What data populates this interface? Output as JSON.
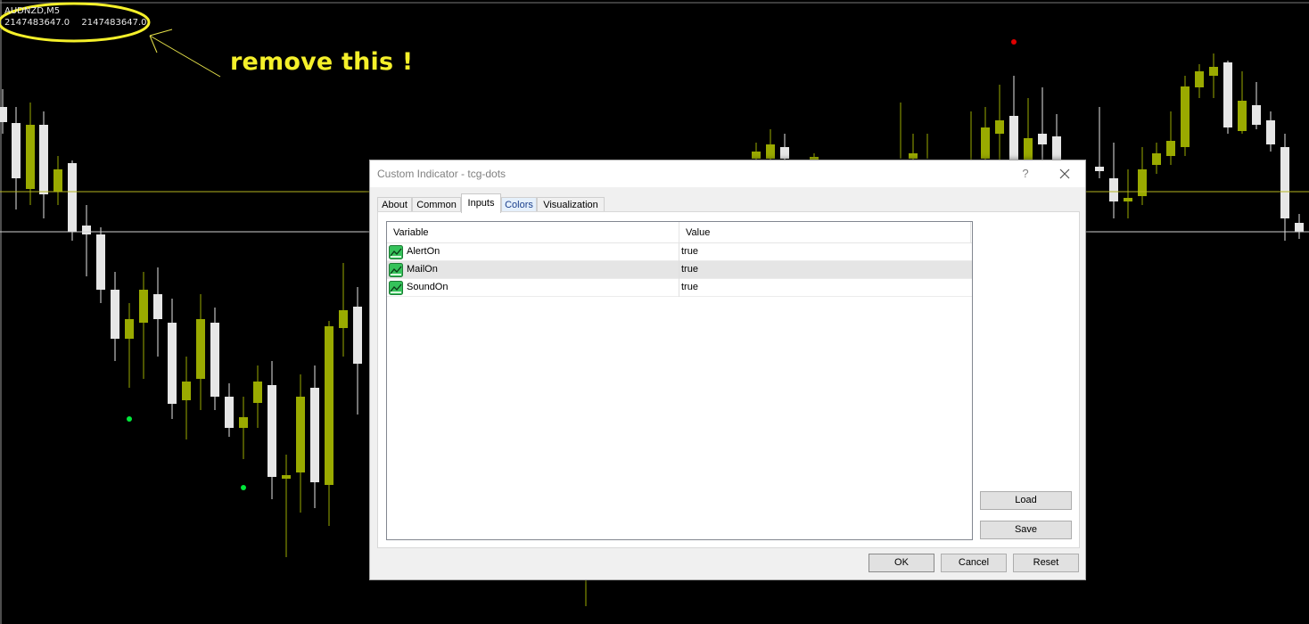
{
  "chart": {
    "symbol_label": "AUDNZD,M5",
    "value_1": "2147483647.0",
    "value_2": "2147483647.0",
    "annotation": "remove this !",
    "colors": {
      "background": "#000000",
      "bull_candle": "#9aaa00",
      "bear_candle": "#e6e6e6",
      "buy_dot": "#00e83a",
      "sell_dot": "#e00000",
      "annotation": "#f5f02a",
      "level_line": "#b5b520",
      "price_line": "#d0d0d0"
    }
  },
  "dialog": {
    "title": "Custom Indicator - tcg-dots",
    "help_label": "?",
    "tabs": [
      {
        "label": "About"
      },
      {
        "label": "Common"
      },
      {
        "label": "Inputs"
      },
      {
        "label": "Colors"
      },
      {
        "label": "Visualization"
      }
    ],
    "active_tab": "Inputs",
    "grid": {
      "headers": {
        "variable": "Variable",
        "value": "Value"
      },
      "rows": [
        {
          "variable": "AlertOn",
          "value": "true"
        },
        {
          "variable": "MailOn",
          "value": "true"
        },
        {
          "variable": "SoundOn",
          "value": "true"
        }
      ],
      "selected_row": 1
    },
    "buttons": {
      "load": "Load",
      "save": "Save",
      "ok": "OK",
      "cancel": "Cancel",
      "reset": "Reset"
    }
  }
}
